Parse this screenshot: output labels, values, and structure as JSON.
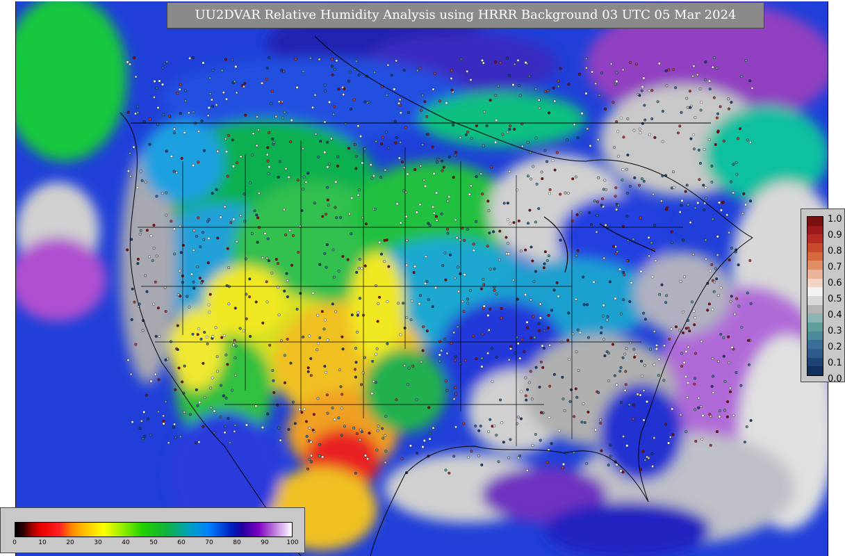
{
  "title": "UU2DVAR Relative Humidity Analysis using HRRR Background 03 UTC 05 Mar 2024",
  "colorbar_right": {
    "ticks": [
      "1.0",
      "0.9",
      "0.8",
      "0.7",
      "0.6",
      "0.5",
      "0.4",
      "0.3",
      "0.2",
      "0.1",
      "0.0"
    ],
    "colors": [
      "#7a1010",
      "#9e1a1a",
      "#b52a22",
      "#c84a2c",
      "#d66a3c",
      "#e08c64",
      "#eab298",
      "#f4d4c4",
      "#f2f2f2",
      "#d8d8d8",
      "#b4b4b4",
      "#8cb4b4",
      "#5f9e9a",
      "#4a8a9a",
      "#3a6e98",
      "#2e5a8c",
      "#1e4476",
      "#12305e"
    ]
  },
  "colorbar_bottom": {
    "ticks": [
      "0",
      "10",
      "20",
      "30",
      "40",
      "50",
      "60",
      "70",
      "80",
      "90",
      "100"
    ]
  }
}
